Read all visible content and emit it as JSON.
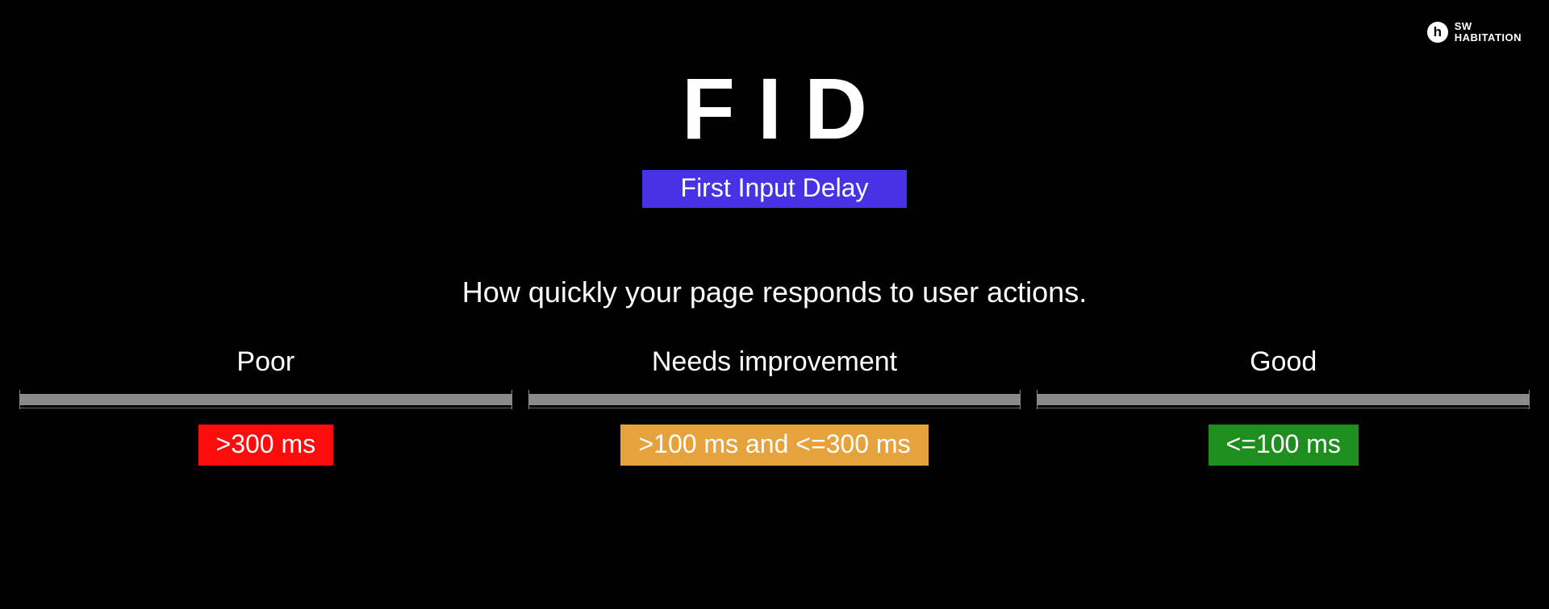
{
  "logo": {
    "mark_letter": "h",
    "line1": "SW",
    "line2": "HABITATION"
  },
  "headline": {
    "acronym": "FID",
    "subtitle": "First Input Delay",
    "tagline": "How quickly your page responds to user actions."
  },
  "buckets": {
    "poor": {
      "label": "Poor",
      "value": ">300 ms"
    },
    "needs": {
      "label": "Needs improvement",
      "value": ">100 ms and <=300 ms"
    },
    "good": {
      "label": "Good",
      "value": "<=100 ms"
    }
  },
  "colors": {
    "background": "#000000",
    "accent_badge": "#4733e5",
    "poor": "#ff0b0b",
    "needs": "#e6a23c",
    "good": "#1e8e1e",
    "bar": "#8a8a8a"
  },
  "chart_data": {
    "type": "table",
    "metric": "FID",
    "metric_full": "First Input Delay",
    "description": "How quickly your page responds to user actions.",
    "unit": "ms",
    "thresholds": [
      {
        "rating": "Poor",
        "condition": ">300 ms",
        "min_ms": 300,
        "max_ms": null,
        "color": "#ff0b0b"
      },
      {
        "rating": "Needs improvement",
        "condition": ">100 ms and <=300 ms",
        "min_ms": 100,
        "max_ms": 300,
        "color": "#e6a23c"
      },
      {
        "rating": "Good",
        "condition": "<=100 ms",
        "min_ms": 0,
        "max_ms": 100,
        "color": "#1e8e1e"
      }
    ]
  }
}
